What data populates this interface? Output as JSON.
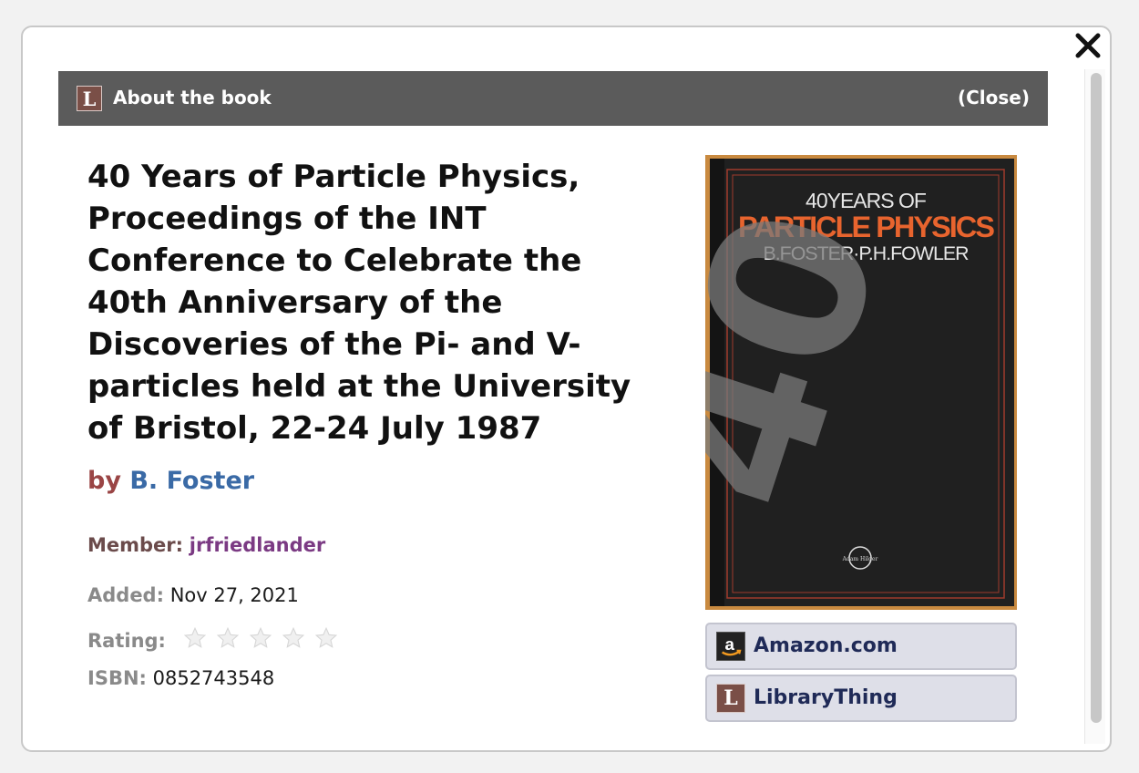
{
  "header": {
    "logo_letter": "L",
    "title": "About the book",
    "close_label": "(Close)"
  },
  "book": {
    "title": "40 Years of Particle Physics, Proceedings of the INT Conference to Celebrate the 40th Anniversary of the Discoveries of the Pi- and V-particles held at the University of Bristol, 22-24 July 1987",
    "by_label": "by",
    "author": "B. Foster",
    "member_label": "Member:",
    "member": "jrfriedlander",
    "added_label": "Added:",
    "added": "Nov 27, 2021",
    "rating_label": "Rating:",
    "rating": 0,
    "rating_max": 5,
    "isbn_label": "ISBN:",
    "isbn": "0852743548"
  },
  "cover": {
    "line1": "40YEARS OF",
    "line2": "PARTICLE PHYSICS",
    "line3": "B.FOSTER·P.H.FOWLER",
    "big_number": "40",
    "publisher_mark": "Adam Hilger"
  },
  "stores": [
    {
      "label": "Amazon.com",
      "icon": "amazon-icon"
    },
    {
      "label": "LibraryThing",
      "icon": "librarything-icon",
      "icon_letter": "L"
    }
  ],
  "colors": {
    "header_bg": "#5b5b5b",
    "author_link": "#3a6aa6",
    "by_color": "#9a4545",
    "member_link": "#7b3a83",
    "button_bg": "#dedfe8",
    "cover_title_orange": "#e8642e"
  }
}
